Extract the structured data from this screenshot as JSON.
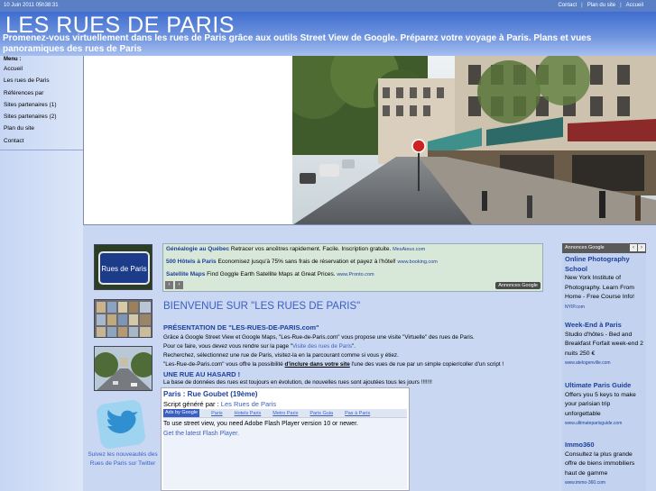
{
  "topbar": {
    "date": "10 Juin 2011 05h38:31",
    "links": [
      "Contact",
      "Plan du site",
      "Accueil"
    ]
  },
  "header": {
    "title": "LES RUES DE PARIS",
    "subtitle": "Promenez-vous virtuellement dans les rues de Paris grâce aux outils Street View de Google. Préparez votre voyage à Paris. Plans et vues panoramiques des rues de Paris"
  },
  "menu": {
    "title": "Menu :",
    "items": [
      "Accueil",
      "Les rues de Paris",
      "Références par",
      "Sites partenaires (1)",
      "Sites partenaires (2)",
      "Plan du site",
      "Contact"
    ]
  },
  "thumbs": {
    "sign_text": "Rues de Paris"
  },
  "twitter": {
    "text": "Suivez les nouveautés des Rues de Paris sur Twitter"
  },
  "top_ads": {
    "items": [
      {
        "title": "Généalogie au Québec",
        "text": "Retracer vos ancêtres rapidement. Facile. Inscription gratuite.",
        "url": "MesAieux.com"
      },
      {
        "title": "500 Hôtels à Paris",
        "text": "Economisez jusqu'à 75% sans frais de réservation et payez à l'hôtel!",
        "url": "www.booking.com"
      },
      {
        "title": "Satellite Maps",
        "text": "Find Goggle Earth Satellite Maps at Great Prices.",
        "url": "www.Pronto.com"
      }
    ],
    "badge": "Annonces Google"
  },
  "main": {
    "welcome": "BIENVENUE SUR \"LES RUES DE PARIS\"",
    "presentation_title": "PRÉSENTATION DE \"LES-RUES-DE-PARIS.com\"",
    "line1": "Grâce à Google Street View et Google Maps, \"Les-Rue-de-Paris.com\" vous propose une visite \"Virtuelle\" des rues de Paris.",
    "line2_pre": "Pour ce faire, vous devez vous rendre sur la page \"",
    "line2_link": "Visite des rues de Paris",
    "line2_post": "\".",
    "line3": "Recherchez, sélectionnez une rue de Paris, visitez-la en la parcourant comme si vous y étiez.",
    "line4_pre": "\"Les-Rue-de-Paris.com\" vous offre la possibilité ",
    "line4_link": "d'inclure dans votre site",
    "line4_post": " l'une des vues de rue par un simple copier/coller d'un script !",
    "line5": "La base de données des rues est toujours en évolution, de nouvelles rues sont ajoutées tous les jours !!!!!!!",
    "random_title": "UNE RUE AU HASARD !"
  },
  "streetbox": {
    "title": "Paris : Rue Goubet (19ème)",
    "script_label": "Script généré par : ",
    "script_link": "Les Rues de Paris",
    "ads_label": "Ads by Google",
    "ad_links": [
      "Paris",
      "Hotels Paris",
      "Metro Paris",
      "Paris Guia",
      "Pas à Paris"
    ],
    "flash_text": "To use street view, you need Adobe Flash Player version 10 or newer.",
    "flash_link": "Get the latest Flash Player."
  },
  "right_ads": {
    "header": "Annonces Google",
    "items": [
      {
        "title": "Online Photography School",
        "text": "New York Institute of Photography. Learn From Home - Free Course Info!",
        "url": "NYIP.com"
      },
      {
        "title": "Week-End à Paris",
        "text": "Studio d'hôtes - Bed and Breakfast Forfait week-end 2 nuits 250 €",
        "url": "www.atelogenville.com"
      },
      {
        "title": "Ultimate Paris Guide",
        "text": "Offers you 5 keys to make your parisian trip unforgettable",
        "url": "www.ultimateparisguide.com"
      },
      {
        "title": "Immo360",
        "text": "Consultez la plus grande offre de biens immobiliers haut de gamme",
        "url": "www.immo-360.com"
      }
    ]
  },
  "colors": {
    "topbar": "#5a7fc4",
    "header_top": "#3f6dd0",
    "content_bg": "#c9d7f3",
    "link_blue": "#3a5fc0",
    "title_blue": "#1d3f9a"
  }
}
